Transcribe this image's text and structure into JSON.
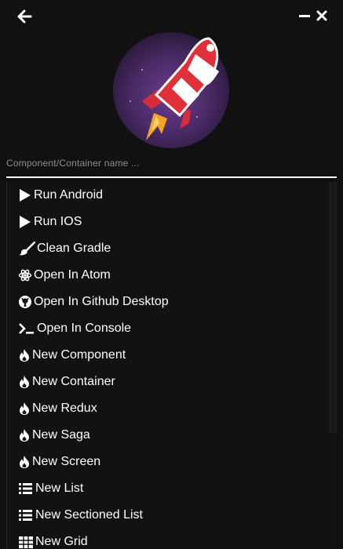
{
  "window": {
    "back_icon": "arrow-left-icon",
    "minimize_icon": "minimize-icon",
    "close_icon": "close-icon"
  },
  "logo": {
    "icon": "rocket-logo",
    "colors": {
      "circle_outer": "#2a1a3e",
      "circle_inner": "#6b3a8e",
      "rocket_red": "#e0303a",
      "rocket_white": "#ffffff",
      "flame": "#f5a623"
    }
  },
  "search": {
    "placeholder": "Component/Container name ...",
    "value": ""
  },
  "menu": {
    "items": [
      {
        "label": "Run Android",
        "icon": "play-icon"
      },
      {
        "label": "Run IOS",
        "icon": "play-icon"
      },
      {
        "label": "Clean Gradle",
        "icon": "paint-brush-icon"
      },
      {
        "label": "Open In Atom",
        "icon": "atom-icon"
      },
      {
        "label": "Open In Github Desktop",
        "icon": "github-icon"
      },
      {
        "label": "Open In Console",
        "icon": "terminal-icon"
      },
      {
        "label": "New Component",
        "icon": "flame-icon"
      },
      {
        "label": "New Container",
        "icon": "flame-icon"
      },
      {
        "label": "New Redux",
        "icon": "flame-icon"
      },
      {
        "label": "New Saga",
        "icon": "flame-icon"
      },
      {
        "label": "New Screen",
        "icon": "flame-icon"
      },
      {
        "label": "New List",
        "icon": "list-icon"
      },
      {
        "label": "New Sectioned List",
        "icon": "list-icon"
      },
      {
        "label": "New Grid",
        "icon": "grid-icon"
      }
    ]
  },
  "colors": {
    "background": "#111111",
    "text": "#ffffff",
    "placeholder": "#8f8f8f"
  }
}
